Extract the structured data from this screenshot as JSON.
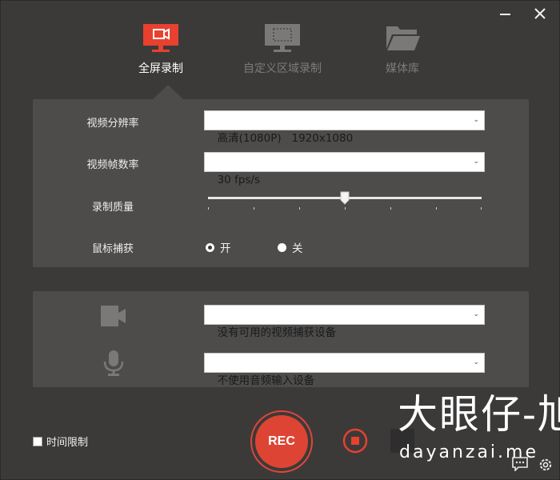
{
  "window": {
    "minimize_label": "minimize",
    "close_label": "close"
  },
  "tabs": [
    {
      "label": "全屏录制",
      "active": true,
      "icon": "monitor-video-icon"
    },
    {
      "label": "自定义区域录制",
      "active": false,
      "icon": "monitor-region-icon"
    },
    {
      "label": "媒体库",
      "active": false,
      "icon": "folder-icon"
    }
  ],
  "settings": {
    "resolution": {
      "label": "视频分辨率",
      "value": "高清(1080P)   1920x1080"
    },
    "framerate": {
      "label": "视频帧数率",
      "value": "30 fps/s"
    },
    "quality": {
      "label": "录制质量",
      "level": 0.5,
      "ticks": 7
    },
    "mouse": {
      "label": "鼠标捕获",
      "on_label": "开",
      "off_label": "关",
      "selected": "开"
    }
  },
  "devices": {
    "video": {
      "icon": "camera-icon",
      "value": "没有可用的视频捕获设备"
    },
    "audio": {
      "icon": "microphone-icon",
      "value": "不使用音频输入设备"
    }
  },
  "footer": {
    "time_limit_label": "时间限制",
    "time_limit_checked": false,
    "rec_label": "REC",
    "watermark_cn": "大眼仔-旭",
    "watermark_en": "dayanzai.me"
  },
  "colors": {
    "background": "#3b3a39",
    "panel": "#4d4c4b",
    "accent": "#e0463a",
    "tab_inactive": "#7c7b7a"
  }
}
